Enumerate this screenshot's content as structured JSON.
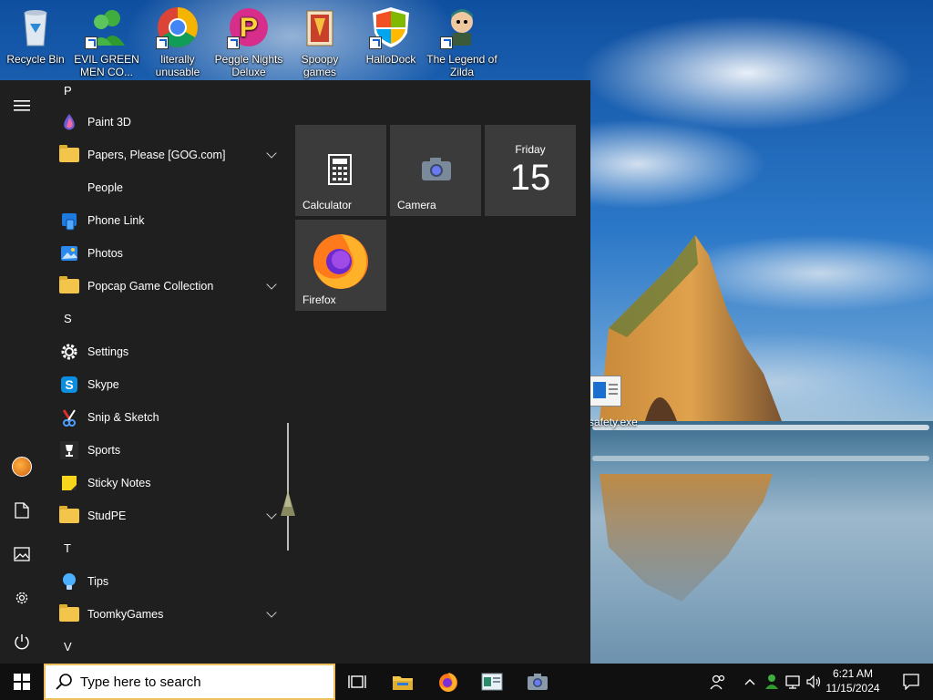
{
  "desktop": {
    "icons": [
      {
        "label": "Recycle Bin"
      },
      {
        "label": "EVIL GREEN MEN CO..."
      },
      {
        "label": "literally unusable"
      },
      {
        "label": "Peggle Nights Deluxe"
      },
      {
        "label": "Spoopy games"
      },
      {
        "label": "HalloDock"
      },
      {
        "label": "The Legend of Zilda"
      }
    ],
    "safety_label": "safety.exe"
  },
  "start_menu": {
    "sections": [
      {
        "letter": "P",
        "apps": [
          {
            "label": "Paint 3D",
            "icon": "paint3d-icon",
            "expandable": false
          },
          {
            "label": "Papers, Please [GOG.com]",
            "icon": "folder-icon",
            "expandable": true
          },
          {
            "label": "People",
            "icon": "none",
            "expandable": false
          },
          {
            "label": "Phone Link",
            "icon": "phone-link-icon",
            "expandable": false
          },
          {
            "label": "Photos",
            "icon": "photos-icon",
            "expandable": false
          },
          {
            "label": "Popcap Game Collection",
            "icon": "folder-icon",
            "expandable": true
          }
        ]
      },
      {
        "letter": "S",
        "apps": [
          {
            "label": "Settings",
            "icon": "gear-icon",
            "expandable": false
          },
          {
            "label": "Skype",
            "icon": "skype-icon",
            "expandable": false
          },
          {
            "label": "Snip & Sketch",
            "icon": "snip-icon",
            "expandable": false
          },
          {
            "label": "Sports",
            "icon": "trophy-icon",
            "expandable": false
          },
          {
            "label": "Sticky Notes",
            "icon": "sticky-notes-icon",
            "expandable": false
          },
          {
            "label": "StudPE",
            "icon": "folder-icon",
            "expandable": true
          }
        ]
      },
      {
        "letter": "T",
        "apps": [
          {
            "label": "Tips",
            "icon": "tips-icon",
            "expandable": false
          },
          {
            "label": "ToomkyGames",
            "icon": "folder-icon",
            "expandable": true
          }
        ]
      },
      {
        "letter": "V",
        "apps": []
      }
    ],
    "tiles": {
      "calculator": "Calculator",
      "camera": "Camera",
      "calendar_day": "Friday",
      "calendar_date": "15",
      "firefox": "Firefox"
    }
  },
  "taskbar": {
    "search_placeholder": "Type here to search",
    "time": "6:21 AM",
    "date": "11/15/2024"
  },
  "colors": {
    "menu_bg": "#1f1f1f",
    "tile_bg": "#3b3b3b",
    "taskbar_bg": "#101010",
    "folder": "#f3c54a"
  }
}
